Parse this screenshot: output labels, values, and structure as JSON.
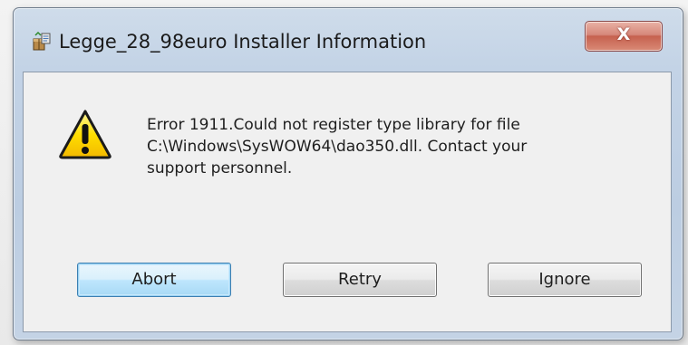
{
  "window": {
    "title": "Legge_28_98euro Installer Information",
    "close_glyph": "X"
  },
  "message": {
    "lines": [
      "Error 1911.Could not register type library for file",
      "C:\\Windows\\SysWOW64\\dao350.dll.  Contact your",
      "support personnel."
    ],
    "icon": "warning-icon"
  },
  "buttons": {
    "abort": "Abort",
    "retry": "Retry",
    "ignore": "Ignore",
    "default": "abort"
  },
  "colors": {
    "warning_yellow": "#ffde00",
    "close_red": "#c6614f",
    "default_button_blue": "#3c7fb1"
  }
}
